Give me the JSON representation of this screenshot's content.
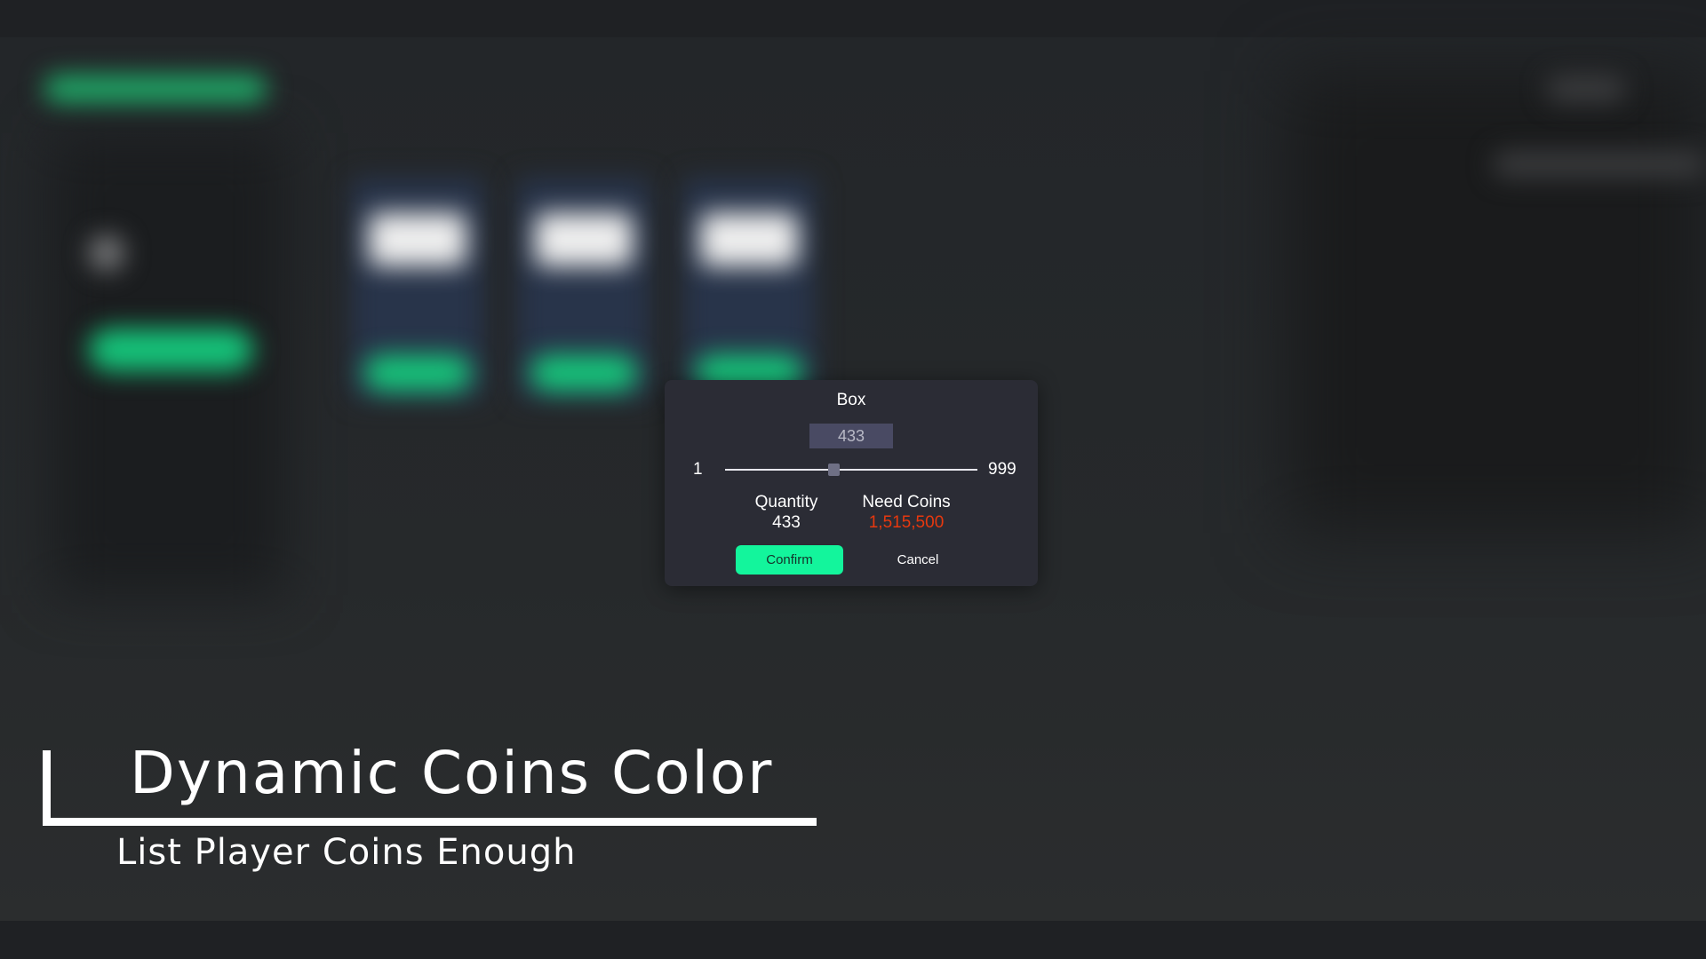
{
  "dialog": {
    "title": "Box",
    "input_value": "433",
    "slider": {
      "min_label": "1",
      "max_label": "999",
      "min": 1,
      "max": 999,
      "value": 433
    },
    "quantity_label": "Quantity",
    "quantity_value": "433",
    "coins_label": "Need Coins",
    "coins_value": "1,515,500",
    "coins_value_color": "#e8380e",
    "confirm_label": "Confirm",
    "cancel_label": "Cancel"
  },
  "caption": {
    "title": "Dynamic Coins Color",
    "subtitle": "List Player Coins Enough"
  },
  "colors": {
    "confirm_button": "#13f59c",
    "dialog_background": "#2b2c35",
    "background": "#1f2124"
  }
}
